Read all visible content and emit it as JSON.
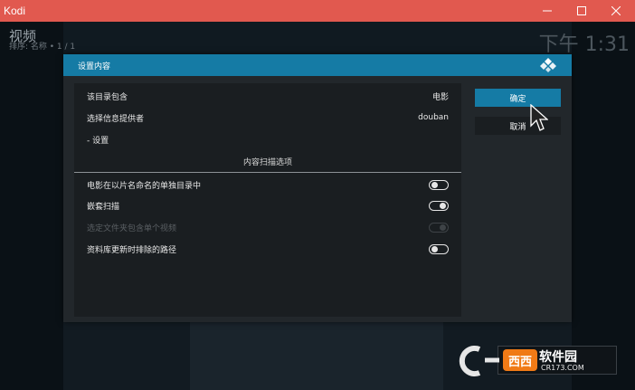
{
  "window": {
    "title": "Kodi",
    "controls": {
      "minimize": "minimize-icon",
      "maximize": "maximize-icon",
      "close": "close-icon"
    }
  },
  "background": {
    "title": "视频",
    "subtitle": "排序: 名称 • 1 / 1",
    "clock": "下午 1:31"
  },
  "dialog": {
    "title": "设置内容",
    "rows": [
      {
        "label": "该目录包含",
        "value": "电影"
      },
      {
        "label": "选择信息提供者",
        "value": "douban"
      },
      {
        "label": "- 设置"
      }
    ],
    "section_header": "内容扫描选项",
    "toggles": [
      {
        "label": "电影在以片名命名的单独目录中",
        "state": "off",
        "enabled": true
      },
      {
        "label": "嵌套扫描",
        "state": "on",
        "enabled": true
      },
      {
        "label": "选定文件夹包含单个视频",
        "state": "on",
        "enabled": false
      },
      {
        "label": "资料库更新时排除的路径",
        "state": "off",
        "enabled": true
      }
    ],
    "buttons": {
      "ok": "确定",
      "cancel": "取消"
    }
  },
  "watermark": {
    "brand": "软件园",
    "mark": "西西",
    "url": "CR173.COM"
  },
  "colors": {
    "titlebar": "#e1594f",
    "accent": "#157ba5",
    "panel": "#1a1e21",
    "dialog": "#22272b"
  }
}
